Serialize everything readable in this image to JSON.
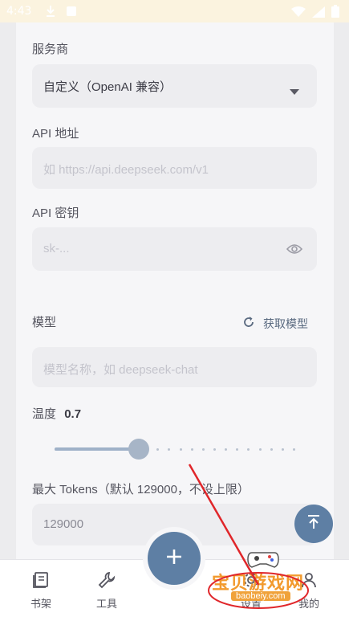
{
  "status": {
    "time": "4:43"
  },
  "provider": {
    "label": "服务商",
    "value": "自定义（OpenAI 兼容）"
  },
  "api_url": {
    "label": "API 地址",
    "placeholder": "如 https://api.deepseek.com/v1"
  },
  "api_key": {
    "label": "API 密钥",
    "placeholder": "sk-..."
  },
  "model": {
    "label": "模型",
    "fetch_label": "获取模型",
    "placeholder": "模型名称，如 deepseek-chat"
  },
  "temperature": {
    "label": "温度",
    "value": "0.7",
    "level": 0.35
  },
  "max_tokens": {
    "label": "最大 Tokens（默认 129000，不设上限）",
    "value": "129000"
  },
  "nav": {
    "items": [
      {
        "label": "书架"
      },
      {
        "label": "工具"
      },
      {
        "label": "设置"
      },
      {
        "label": "我的"
      }
    ]
  },
  "watermark": {
    "title": "宝贝游戏网",
    "url": "baobeiy.com"
  },
  "colors": {
    "accent": "#5e7fa4",
    "slider": "#a7b5c7",
    "watermark": "#f29a2e",
    "arrow": "#e0262a"
  }
}
